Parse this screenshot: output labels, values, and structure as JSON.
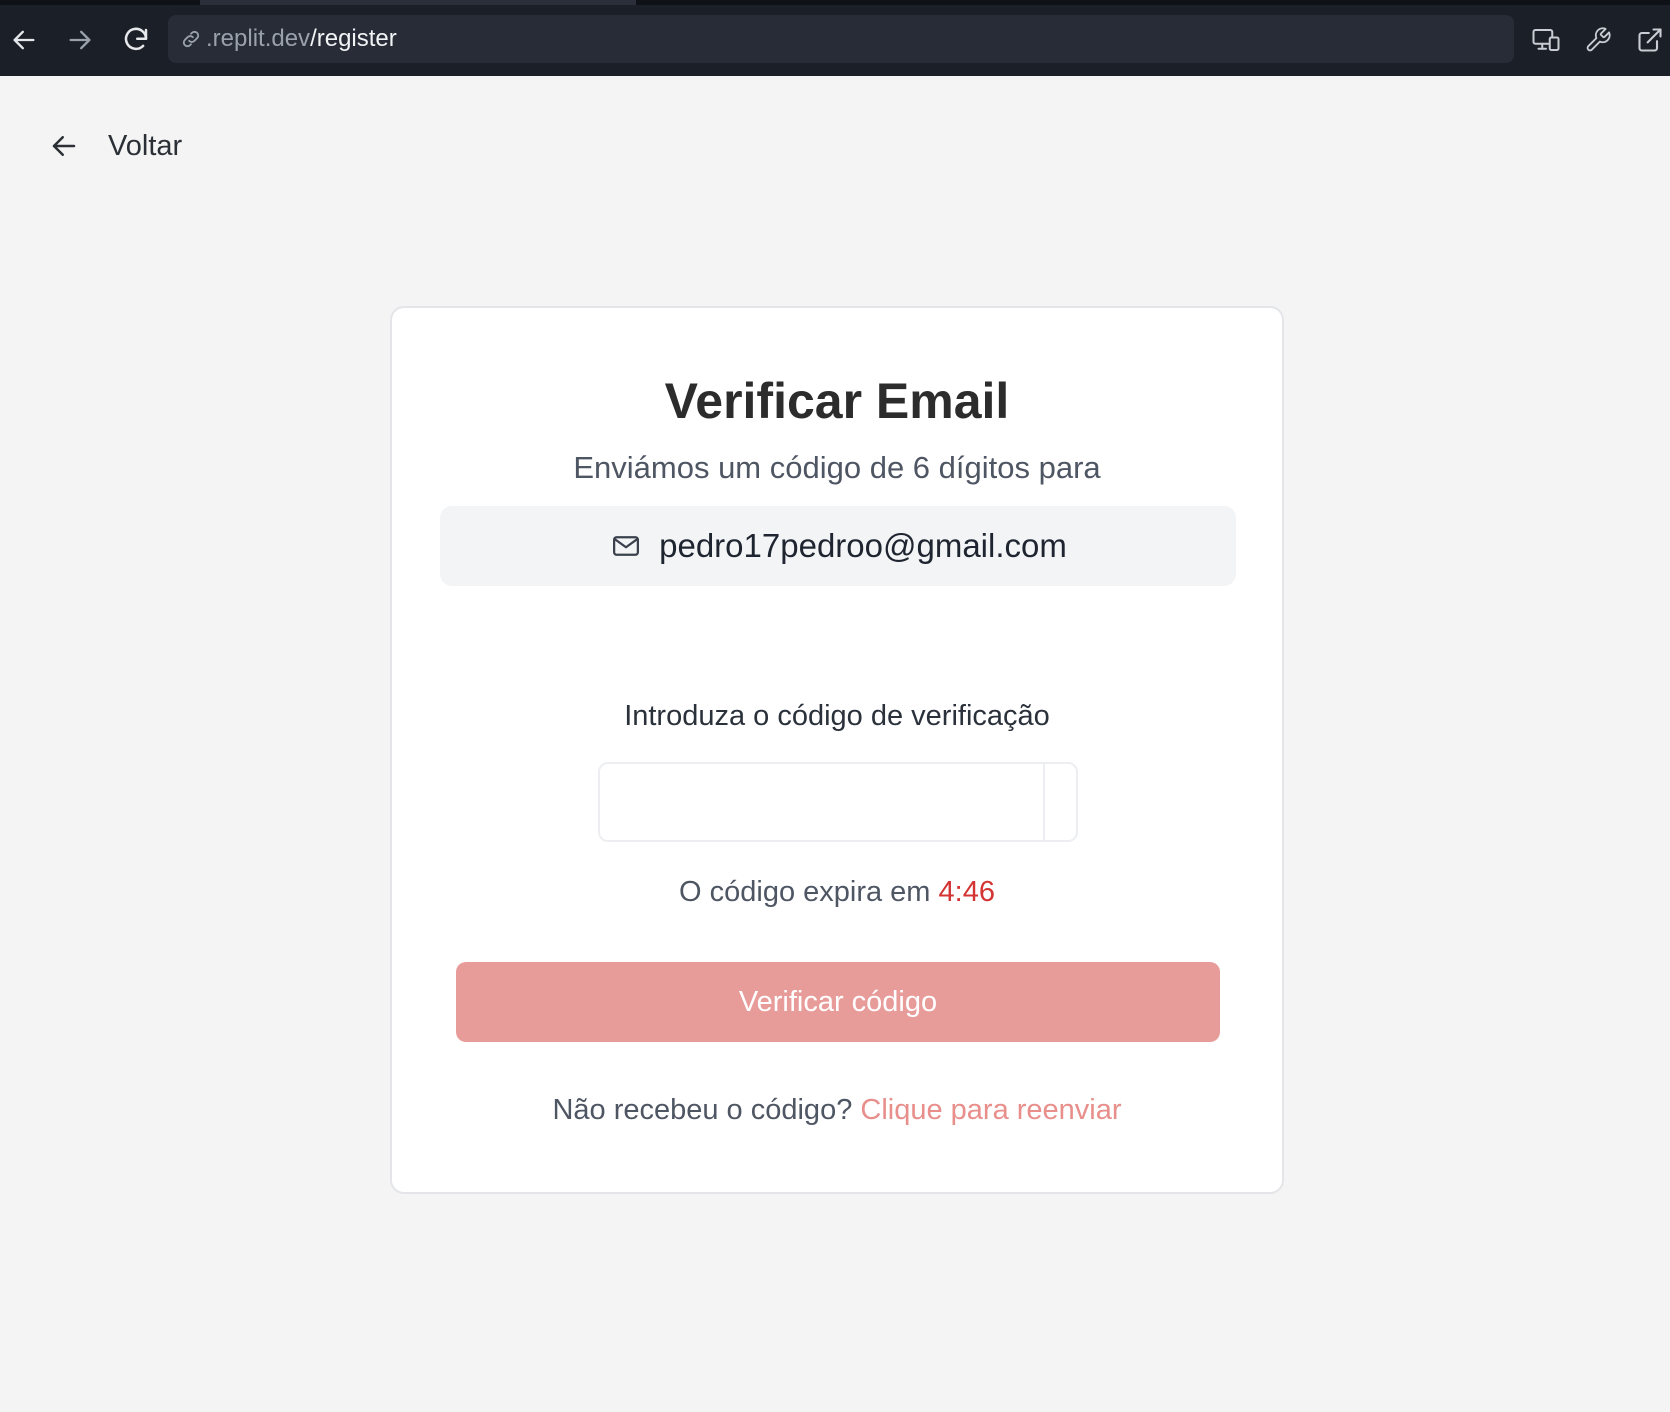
{
  "browser": {
    "url_host": ".replit.dev",
    "url_path": "/register"
  },
  "page": {
    "back_label": "Voltar"
  },
  "card": {
    "title": "Verificar Email",
    "subtitle": "Enviámos um código de 6 dígitos para",
    "email": "pedro17pedroo@gmail.com",
    "code_label": "Introduza o código de verificação",
    "code_digits": [
      "",
      "",
      "",
      "",
      "",
      ""
    ],
    "expiry_prefix": "O código expira em",
    "expiry_time": "4:46",
    "verify_button": "Verificar código",
    "resend_prompt": "Não recebeu o código?",
    "resend_link": "Clique para reenviar"
  },
  "colors": {
    "browser_bar": "#1b1f27",
    "page_background": "#f4f4f4",
    "button_disabled": "#e89c9a",
    "timer": "#d43434",
    "link": "#e88e8b"
  },
  "icons": {
    "back": "arrow-left-icon",
    "forward": "arrow-right-icon",
    "reload": "reload-icon",
    "url": "link-icon",
    "devices": "devices-icon",
    "wrench": "wrench-icon",
    "open_external": "external-link-icon",
    "mail": "mail-icon"
  }
}
